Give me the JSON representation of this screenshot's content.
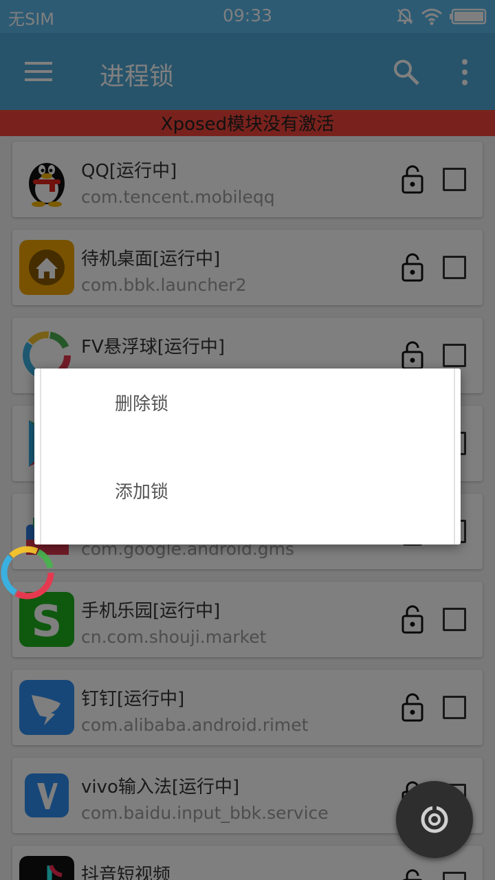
{
  "status_bar": {
    "carrier": "无SIM",
    "time": "09:33"
  },
  "toolbar": {
    "title": "进程锁",
    "menu_icon": "hamburger-menu-icon",
    "search_icon": "search-icon",
    "more_icon": "more-vert-icon"
  },
  "banner": {
    "text": "Xposed模块没有激活"
  },
  "apps": [
    {
      "name": "QQ[运行中]",
      "package": "com.tencent.mobileqq",
      "icon": "qq-penguin-icon"
    },
    {
      "name": "待机桌面[运行中]",
      "package": "com.bbk.launcher2",
      "icon": "home-launcher-icon"
    },
    {
      "name": "FV悬浮球[运行中]",
      "package": "",
      "icon": "fv-ring-icon"
    },
    {
      "name": "",
      "package": "",
      "icon": "play-store-icon"
    },
    {
      "name": "",
      "package": "com.google.android.gms",
      "icon": "google-services-icon"
    },
    {
      "name": "手机乐园[运行中]",
      "package": "cn.com.shouji.market",
      "icon": "shouji-market-icon"
    },
    {
      "name": "钉钉[运行中]",
      "package": "com.alibaba.android.rimet",
      "icon": "dingtalk-icon"
    },
    {
      "name": "vivo输入法[运行中]",
      "package": "com.baidu.input_bbk.service",
      "icon": "vivo-input-icon"
    },
    {
      "name": "抖音短视频",
      "package": "",
      "icon": "douyin-icon"
    }
  ],
  "dialog": {
    "items": [
      "删除锁",
      "添加锁"
    ]
  },
  "colors": {
    "status_bar": "#5ab6e8",
    "toolbar": "#4fa8d6",
    "banner": "#f3443a"
  }
}
